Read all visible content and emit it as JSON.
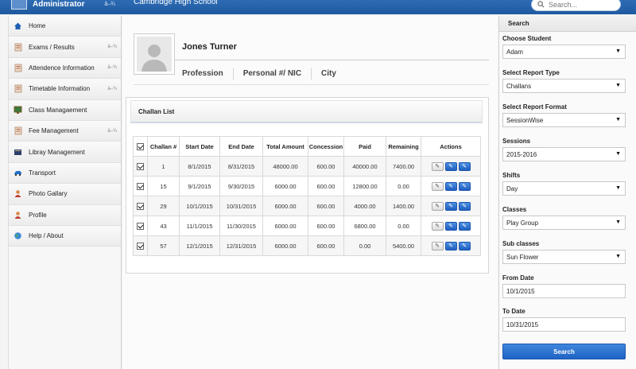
{
  "header": {
    "user_label": "Administrator",
    "user_caret": "â–¾",
    "school_name": "Cambridge High School",
    "search_placeholder": "Search..."
  },
  "sidebar": {
    "items": [
      {
        "label": "Home",
        "icon": "home-icon",
        "caret": ""
      },
      {
        "label": "Exams / Results",
        "icon": "document-icon",
        "caret": "â–¾"
      },
      {
        "label": "Attendence Information",
        "icon": "document-icon",
        "caret": "â–¾"
      },
      {
        "label": "Timetable Information",
        "icon": "document-icon",
        "caret": "â–¾"
      },
      {
        "label": "Class Managaement",
        "icon": "board-icon",
        "caret": ""
      },
      {
        "label": "Fee Management",
        "icon": "document-icon",
        "caret": "â–¾"
      },
      {
        "label": "Libray Management",
        "icon": "book-icon",
        "caret": ""
      },
      {
        "label": "Transport",
        "icon": "car-icon",
        "caret": ""
      },
      {
        "label": "Photo Gallary",
        "icon": "person-icon",
        "caret": ""
      },
      {
        "label": "Profile",
        "icon": "person-icon",
        "caret": ""
      },
      {
        "label": "Help / About",
        "icon": "globe-icon",
        "caret": ""
      }
    ]
  },
  "profile": {
    "name": "Jones Turner",
    "fields": [
      "Profession",
      "Personal #/ NIC",
      "City"
    ]
  },
  "challan": {
    "title": "Challan List",
    "columns": [
      "Challan #",
      "Start Date",
      "End Date",
      "Total Amount",
      "Concession",
      "Paid",
      "Remaining",
      "Actions"
    ],
    "rows": [
      [
        "1",
        "8/1/2015",
        "8/31/2015",
        "48000.00",
        "600.00",
        "40000.00",
        "7400.00"
      ],
      [
        "15",
        "9/1/2015",
        "9/30/2015",
        "6000.00",
        "600.00",
        "12800.00",
        "0.00"
      ],
      [
        "29",
        "10/1/2015",
        "10/31/2015",
        "6000.00",
        "600.00",
        "4000.00",
        "1400.00"
      ],
      [
        "43",
        "11/1/2015",
        "11/30/2015",
        "6000.00",
        "600.00",
        "6800.00",
        "0.00"
      ],
      [
        "57",
        "12/1/2015",
        "12/31/2015",
        "6000.00",
        "600.00",
        "0.00",
        "5400.00"
      ]
    ]
  },
  "search_panel": {
    "title": "Search",
    "fields": [
      {
        "label": "Choose Student",
        "value": "Adam",
        "type": "select"
      },
      {
        "label": "Select Report Type",
        "value": "Challans",
        "type": "select"
      },
      {
        "label": "Select Report Format",
        "value": "SessionWise",
        "type": "select"
      },
      {
        "label": "Sessions",
        "value": "2015-2016",
        "type": "select"
      },
      {
        "label": "Shifts",
        "value": "Day",
        "type": "select"
      },
      {
        "label": "Classes",
        "value": "Play Group",
        "type": "select"
      },
      {
        "label": "Sub classes",
        "value": "Sun Flower",
        "type": "select"
      },
      {
        "label": "From Date",
        "value": "10/1/2015",
        "type": "text"
      },
      {
        "label": "To Date",
        "value": "10/31/2015",
        "type": "text"
      }
    ],
    "button_label": "Search"
  },
  "colors": {
    "topbar": "#2d6bb4",
    "accent_button": "#1f63c5"
  }
}
